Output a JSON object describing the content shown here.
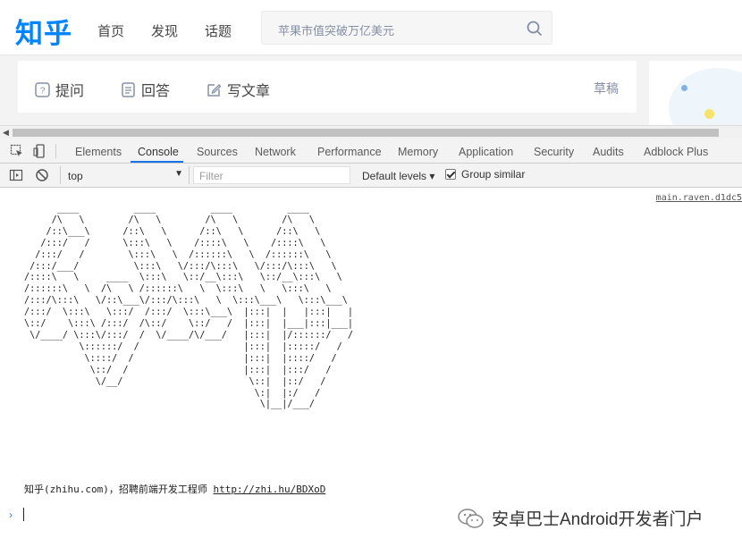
{
  "zhihu": {
    "logo": "知乎",
    "nav": [
      "首页",
      "发现",
      "话题"
    ],
    "search_placeholder": "苹果市值突破万亿美元",
    "actions": [
      "提问",
      "回答",
      "写文章"
    ],
    "draft": "草稿"
  },
  "devtools": {
    "tabs": [
      "Elements",
      "Console",
      "Sources",
      "Network",
      "Performance",
      "Memory",
      "Application",
      "Security",
      "Audits",
      "Adblock Plus"
    ],
    "active_tab": "Console",
    "context": "top",
    "filter_placeholder": "Filter",
    "levels": "Default levels ▾",
    "group_similar": "Group similar",
    "group_similar_checked": true
  },
  "console": {
    "source_link": "main.raven.d1dc5",
    "ascii_art": "      ____          ____          ____          ____\n     /\\   \\        /\\   \\        /\\   \\        /\\   \\\n    /::\\___\\      /::\\   \\      /::\\   \\      /::\\   \\\n   /:::/   /      \\:::\\   \\    /::::\\   \\    /::::\\   \\\n  /:::/   /        \\:::\\   \\  /::::::\\   \\  /::::::\\   \\\n /:::/___/          \\:::\\   \\/:::/\\:::\\   \\/:::/\\:::\\   \\\n/::::\\   \\     ____  \\:::\\   \\::/__\\:::\\   \\::/__\\:::\\   \\\n/::::::\\   \\  /\\   \\ /::::::\\   \\  \\:::\\   \\   \\:::\\   \\\n/:::/\\:::\\   \\/::\\___\\/:::/\\:::\\   \\  \\:::\\___\\   \\:::\\___\\\n/:::/  \\:::\\   \\:::/  /:::/  \\:::\\___\\  |:::|  |   |:::|   |\n\\::/    \\:::\\ /:::/  /\\::/    \\::/   /  |:::|  |___|:::|___|\n \\/____/ \\:::\\/:::/  /  \\/____/\\/___/   |:::|  |/::::::/   /\n          \\::::::/  /                   |:::|  |:::::/   /\n           \\::::/  /                    |:::|  |::::/   /\n            \\::/  /                     |:::|  |:::/   /\n             \\/__/                       \\::|  |::/   /\n                                          \\:|  |:/   /\n                                           \\|__|/___/",
    "hire_text": "知乎(zhihu.com)，招聘前端开发工程师",
    "hire_link": "http://zhi.hu/BDXoD",
    "prompt": "›"
  },
  "watermark": "安卓巴士Android开发者门户",
  "colors": {
    "brand": "#0084ff",
    "devtools_accent": "#1a73e8"
  }
}
